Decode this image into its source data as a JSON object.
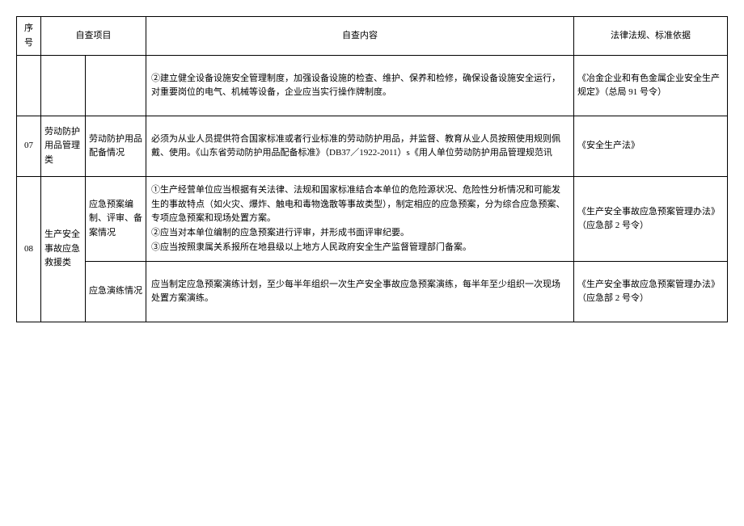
{
  "headers": {
    "seq": "序号",
    "category": "自查项目",
    "content": "自查内容",
    "basis": "法律法规、标准依据"
  },
  "rows": [
    {
      "seq": "",
      "category": "",
      "subcategory": "",
      "content": "②建立健全设备设施安全管理制度，加强设备设施的检查、维护、保养和检修，确保设备设施安全运行，对重要岗位的电气、机械等设备，企业应当实行操作牌制度。",
      "basis": "《冶金企业和有色金属企业安全生产规定》（总局 91 号令）"
    },
    {
      "seq": "07",
      "category": "劳动防护用品管理类",
      "subcategory": "劳动防护用品配备情况",
      "content": "必须为从业人员提供符合国家标准或者行业标准的劳动防护用品，并监督、教育从业人员按照使用规则佩戴、使用。《山东省劳动防护用品配备标准》（DB37／1922-2011）s《用人单位劳动防护用品管理规范讯",
      "basis": "《安全生产法》"
    },
    {
      "seq": "08",
      "category": "生产安全事故应急救援类",
      "sub1": "应急预案编制、评审、备案情况",
      "content1": "①生产经营单位应当根据有关法律、法规和国家标准结合本单位的危险源状况、危险性分析情况和可能发生的事故特点（如火灾、爆炸、触电和毒物逸散等事故类型），制定相应的应急预案，分为综合应急预案、专项应急预案和现场处置方案。\n②应当对本单位编制的应急预案进行评审，并形成书面评审纪要。\n③应当按照隶属关系报所在地县级以上地方人民政府安全生产监督管理部门备案。",
      "basis1": "《生产安全事故应急预案管理办法》（应急部 2 号令）",
      "sub2": "应急演练情况",
      "content2": "应当制定应急预案演练计划，至少每半年组织一次生产安全事故应急预案演练，每半年至少组织一次现场处置方案演练。",
      "basis2": "《生产安全事故应急预案管理办法》（应急部 2 号令）"
    }
  ]
}
